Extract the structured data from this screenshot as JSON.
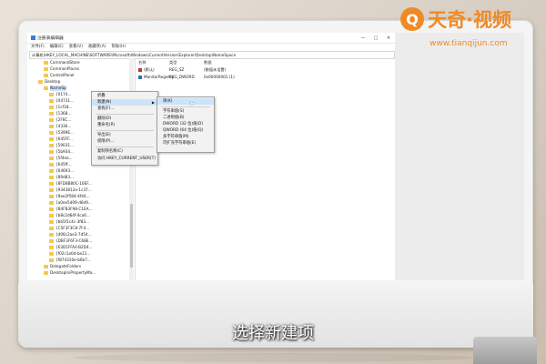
{
  "branding": {
    "logo_mark": "Q",
    "logo_text": "天奇·视频",
    "url": "www.tianqijun.com",
    "accent": "#f08a24"
  },
  "subtitle": "选择新建项",
  "window": {
    "title": "注册表编辑器",
    "menu": [
      "文件(F)",
      "编辑(E)",
      "查看(V)",
      "收藏夹(A)",
      "帮助(H)"
    ],
    "controls": [
      "—",
      "□",
      "✕"
    ],
    "address": "计算机\\HKEY_LOCAL_MACHINE\\SOFTWARE\\Microsoft\\Windows\\CurrentVersion\\Explorer\\Desktop\\NameSpace"
  },
  "tree": {
    "items": [
      {
        "label": "CommandStore"
      },
      {
        "label": "CommonPlaces"
      },
      {
        "label": "ControlPanel"
      },
      {
        "label": "Desktop"
      },
      {
        "label": "NameSp"
      },
      {
        "label": "{0174..."
      },
      {
        "label": "{04731..."
      },
      {
        "label": "{1cf18..."
      },
      {
        "label": "{1368..."
      },
      {
        "label": "{2F6C..."
      },
      {
        "label": "{4336..."
      },
      {
        "label": "{5399E..."
      },
      {
        "label": "{645FF..."
      },
      {
        "label": "{59031..."
      },
      {
        "label": "{5b934..."
      },
      {
        "label": "{5f4ea..."
      },
      {
        "label": "{645ff..."
      },
      {
        "label": "{64693..."
      },
      {
        "label": "{89d83..."
      },
      {
        "label": "{8FD8B80C-10EF..."
      },
      {
        "label": "{9343812e-1c37..."
      },
      {
        "label": "{9ae2f584-4f44..."
      },
      {
        "label": "{a0ee5d09-d6d9..."
      },
      {
        "label": "{B4FB3F98-C1EA..."
      },
      {
        "label": "{b8c2d64f-4ca6..."
      },
      {
        "label": "{bb5f1c4c-3f83..."
      },
      {
        "label": "{C5F3F3C8-7F4..."
      },
      {
        "label": "{d06c2ae3-7d54..."
      },
      {
        "label": "{DBF3F6F3-C68E..."
      },
      {
        "label": "{E3D1FFA4-B2D4..."
      },
      {
        "label": "{f02c1a0d-be21..."
      },
      {
        "label": "{f874310e-b6b7..."
      },
      {
        "label": "DelegateFolders"
      },
      {
        "label": "DesktopIniPropertyMa..."
      }
    ]
  },
  "values": {
    "headers": [
      "名称",
      "类型",
      "数据"
    ],
    "rows": [
      {
        "name": "(默认)",
        "type": "REG_SZ",
        "data": "(数值未设置)"
      },
      {
        "name": "MonitorRegistry",
        "type": "REG_DWORD",
        "data": "0x00000001 (1)"
      }
    ]
  },
  "context_menu": {
    "items": [
      "折叠",
      "新建(N)",
      "查找(F)...",
      "删除(D)",
      "重命名(R)",
      "导出(E)",
      "权限(P)...",
      "复制项名称(C)",
      "访问 HKEY_CURRENT_USER(T)"
    ]
  },
  "submenu": {
    "items": [
      "项(K)",
      "字符串值(S)",
      "二进制值(B)",
      "DWORD (32 位)值(D)",
      "QWORD (64 位)值(Q)",
      "多字符串值(M)",
      "可扩充字符串值(E)"
    ]
  }
}
